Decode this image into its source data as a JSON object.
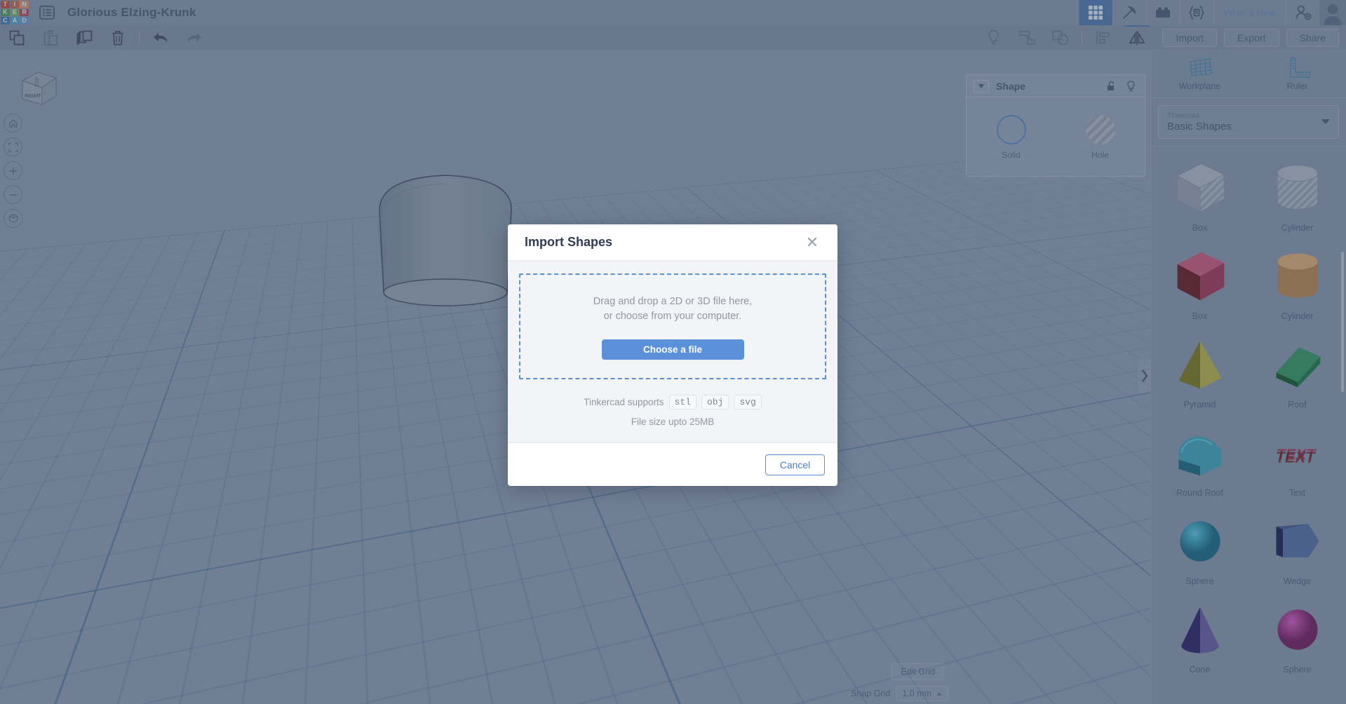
{
  "app": {
    "logo_letters": [
      "T",
      "I",
      "N",
      "K",
      "E",
      "R",
      "C",
      "A",
      "D"
    ],
    "logo_colors": [
      "#c0392b",
      "#c0563d",
      "#d98a5a",
      "#3f8f4a",
      "#6fa05c",
      "#b03a4a",
      "#2f6fb0",
      "#3d9bbf",
      "#5b8fd0"
    ],
    "document_title": "Glorious Elzing-Krunk",
    "menu_icon": "list-menu-icon"
  },
  "topbar": {
    "icons": [
      {
        "name": "grid-apps-icon",
        "active": true
      },
      {
        "name": "hammer-pick-icon",
        "active": false
      },
      {
        "name": "brick-blocks-icon",
        "active": false
      },
      {
        "name": "codeblocks-icon",
        "active": false
      }
    ],
    "whats_new": "What's New",
    "invite_icon": "add-user-icon",
    "avatar_icon": "user-avatar"
  },
  "toolbar": {
    "left_tools": [
      {
        "name": "copy-icon",
        "enabled": true
      },
      {
        "name": "paste-icon",
        "enabled": false
      },
      {
        "name": "duplicate-icon",
        "enabled": true
      },
      {
        "name": "delete-trash-icon",
        "enabled": true
      },
      {
        "name": "undo-icon",
        "enabled": true
      },
      {
        "name": "redo-icon",
        "enabled": false
      }
    ],
    "right_tools": [
      {
        "name": "lightbulb-icon",
        "enabled": false
      },
      {
        "name": "group-icon",
        "enabled": false
      },
      {
        "name": "ungroup-icon",
        "enabled": false
      },
      {
        "name": "align-icon",
        "enabled": false
      },
      {
        "name": "mirror-flip-icon",
        "enabled": true
      }
    ],
    "import_label": "Import",
    "export_label": "Export",
    "share_label": "Share"
  },
  "viewcube": {
    "top_face": "TOP",
    "front_face": "RIGHT",
    "nav_buttons": [
      {
        "name": "home-view-icon"
      },
      {
        "name": "fit-to-view-icon"
      },
      {
        "name": "zoom-in-icon"
      },
      {
        "name": "zoom-out-icon"
      },
      {
        "name": "perspective-toggle-icon"
      }
    ]
  },
  "shape_panel": {
    "title": "Shape",
    "collapse_icon": "chevron-down-icon",
    "lock_icon": "unlock-icon",
    "visibility_icon": "lightbulb-icon",
    "options": [
      {
        "label": "Solid",
        "type": "solid"
      },
      {
        "label": "Hole",
        "type": "hole"
      }
    ]
  },
  "sidebar": {
    "tools": [
      {
        "label": "Workplane",
        "icon": "workplane-icon"
      },
      {
        "label": "Ruler",
        "icon": "ruler-icon"
      }
    ],
    "library": {
      "owner": "Tinkercad",
      "name": "Basic Shapes",
      "chevron_icon": "chevron-down-icon"
    },
    "shapes": [
      {
        "name": "Box",
        "kind": "box",
        "color": "#9aa7b5",
        "hole": true
      },
      {
        "name": "Cylinder",
        "kind": "cylinder",
        "color": "#9aa7b5",
        "hole": true
      },
      {
        "name": "Box",
        "kind": "box",
        "color": "#9e1f43",
        "hole": false
      },
      {
        "name": "Cylinder",
        "kind": "cylinder",
        "color": "#b5783c",
        "hole": false
      },
      {
        "name": "Pyramid",
        "kind": "pyramid",
        "color": "#b5ab35",
        "hole": false
      },
      {
        "name": "Roof",
        "kind": "roof",
        "color": "#1f8a52",
        "hole": false
      },
      {
        "name": "Round Roof",
        "kind": "roundroof",
        "color": "#2b9bb5",
        "hole": false
      },
      {
        "name": "Text",
        "kind": "text",
        "color": "#9e1f43",
        "hole": false
      },
      {
        "name": "Sphere",
        "kind": "sphere",
        "color": "#1b9ab8",
        "hole": false
      },
      {
        "name": "Wedge",
        "kind": "wedge",
        "color": "#2c4b85",
        "hole": false
      },
      {
        "name": "Cone",
        "kind": "cone",
        "color": "#5a4a99",
        "hole": false
      },
      {
        "name": "Sphere",
        "kind": "sphere",
        "color": "#a81f8e",
        "hole": false
      }
    ],
    "expand_icon": "chevron-right-icon"
  },
  "grid_controls": {
    "edit_grid_label": "Edit Grid",
    "snap_grid_label": "Snap Grid",
    "snap_grid_value": "1.0 mm",
    "snap_chevron_icon": "chevron-up-icon"
  },
  "modal": {
    "title": "Import Shapes",
    "close_icon": "close-x-icon",
    "dropzone_line1": "Drag and drop a 2D or 3D file here,",
    "dropzone_line2": "or choose from your computer.",
    "choose_file_label": "Choose a file",
    "support_text": "Tinkercad supports",
    "formats": [
      "stl",
      "obj",
      "svg"
    ],
    "file_size_note": "File size upto 25MB",
    "cancel_label": "Cancel"
  },
  "colors": {
    "accent_blue": "#5b91d8",
    "canvas_bg": "#8493aa",
    "chrome_bg": "#7d8ca3",
    "text_dark": "#3b4a63"
  }
}
